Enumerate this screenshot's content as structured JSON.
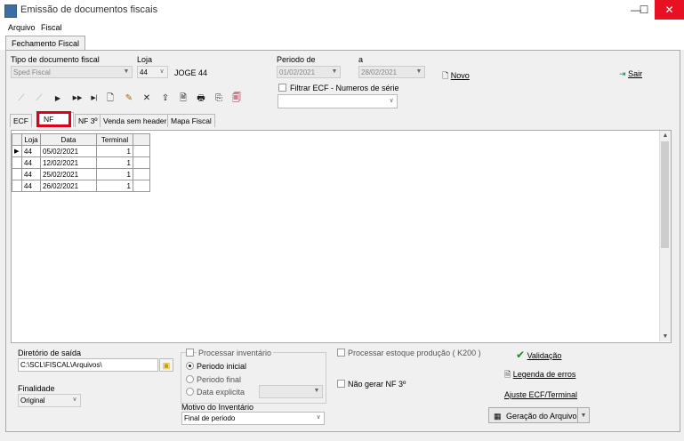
{
  "window": {
    "title": "Emissão de documentos fiscais",
    "minimize": "—",
    "maximize": "☐",
    "close": "✕"
  },
  "menu": {
    "items": [
      "Arquivo",
      "Fiscal"
    ]
  },
  "main_tab": "Fechamento Fiscal",
  "form": {
    "tipo_label": "Tipo de documento fiscal",
    "tipo_value": "Sped Fiscal",
    "loja_label": "Loja",
    "loja_value": "44",
    "loja_name": "JOGE 44",
    "periodo_label": "Periodo de",
    "periodo_a_label": "a",
    "periodo_inicio": "01/02/2021",
    "periodo_fim": "28/02/2021",
    "filtrar_label": "Filtrar ECF - Numeros de série",
    "novo_label": "Novo",
    "sair_label": "Sair"
  },
  "toolbar": {
    "icons": [
      "first-icon",
      "prev-icon",
      "next-icon",
      "fast-forward-icon",
      "last-icon",
      "new-doc-icon",
      "edit-icon",
      "delete-icon",
      "export-icon",
      "preview-icon",
      "print-icon",
      "copy-icon",
      "report-icon"
    ],
    "glyphs": [
      "⟋",
      "⟋",
      "▶",
      "▶▶",
      "▶|",
      "🗋",
      "✎",
      "✕",
      "⇪",
      "🗎",
      "🖶",
      "⎘",
      "🗐"
    ]
  },
  "subtabs": [
    "ECF",
    "NF",
    "NF 3º",
    "Venda sem header",
    "Mapa Fiscal"
  ],
  "grid": {
    "columns": [
      "Loja",
      "Data",
      "Terminal"
    ],
    "rows": [
      {
        "loja": "44",
        "data": "05/02/2021",
        "terminal": "1"
      },
      {
        "loja": "44",
        "data": "12/02/2021",
        "terminal": "1"
      },
      {
        "loja": "44",
        "data": "25/02/2021",
        "terminal": "1"
      },
      {
        "loja": "44",
        "data": "26/02/2021",
        "terminal": "1"
      }
    ]
  },
  "bottom": {
    "diretorio_label": "Diretório de saída",
    "diretorio_value": "C:\\SCL\\FISCAL\\Arquivos\\",
    "finalidade_label": "Finalidade",
    "finalidade_value": "Original",
    "processar_inventario": "Processar inventário",
    "periodo_inicial": "Periodo inicial",
    "periodo_final": "Periodo final",
    "data_explicita": "Data explicita",
    "motivo_label": "Motivo do Inventário",
    "motivo_value": "Final de periodo",
    "processar_estoque": "Processar estoque produção ( K200 )",
    "nao_gerar": "Não gerar NF 3º",
    "validacao": "Validação",
    "legenda": "Legenda de erros",
    "ajuste": "Ajuste ECF/Terminal",
    "geracao": "Geração do Arquivo"
  }
}
